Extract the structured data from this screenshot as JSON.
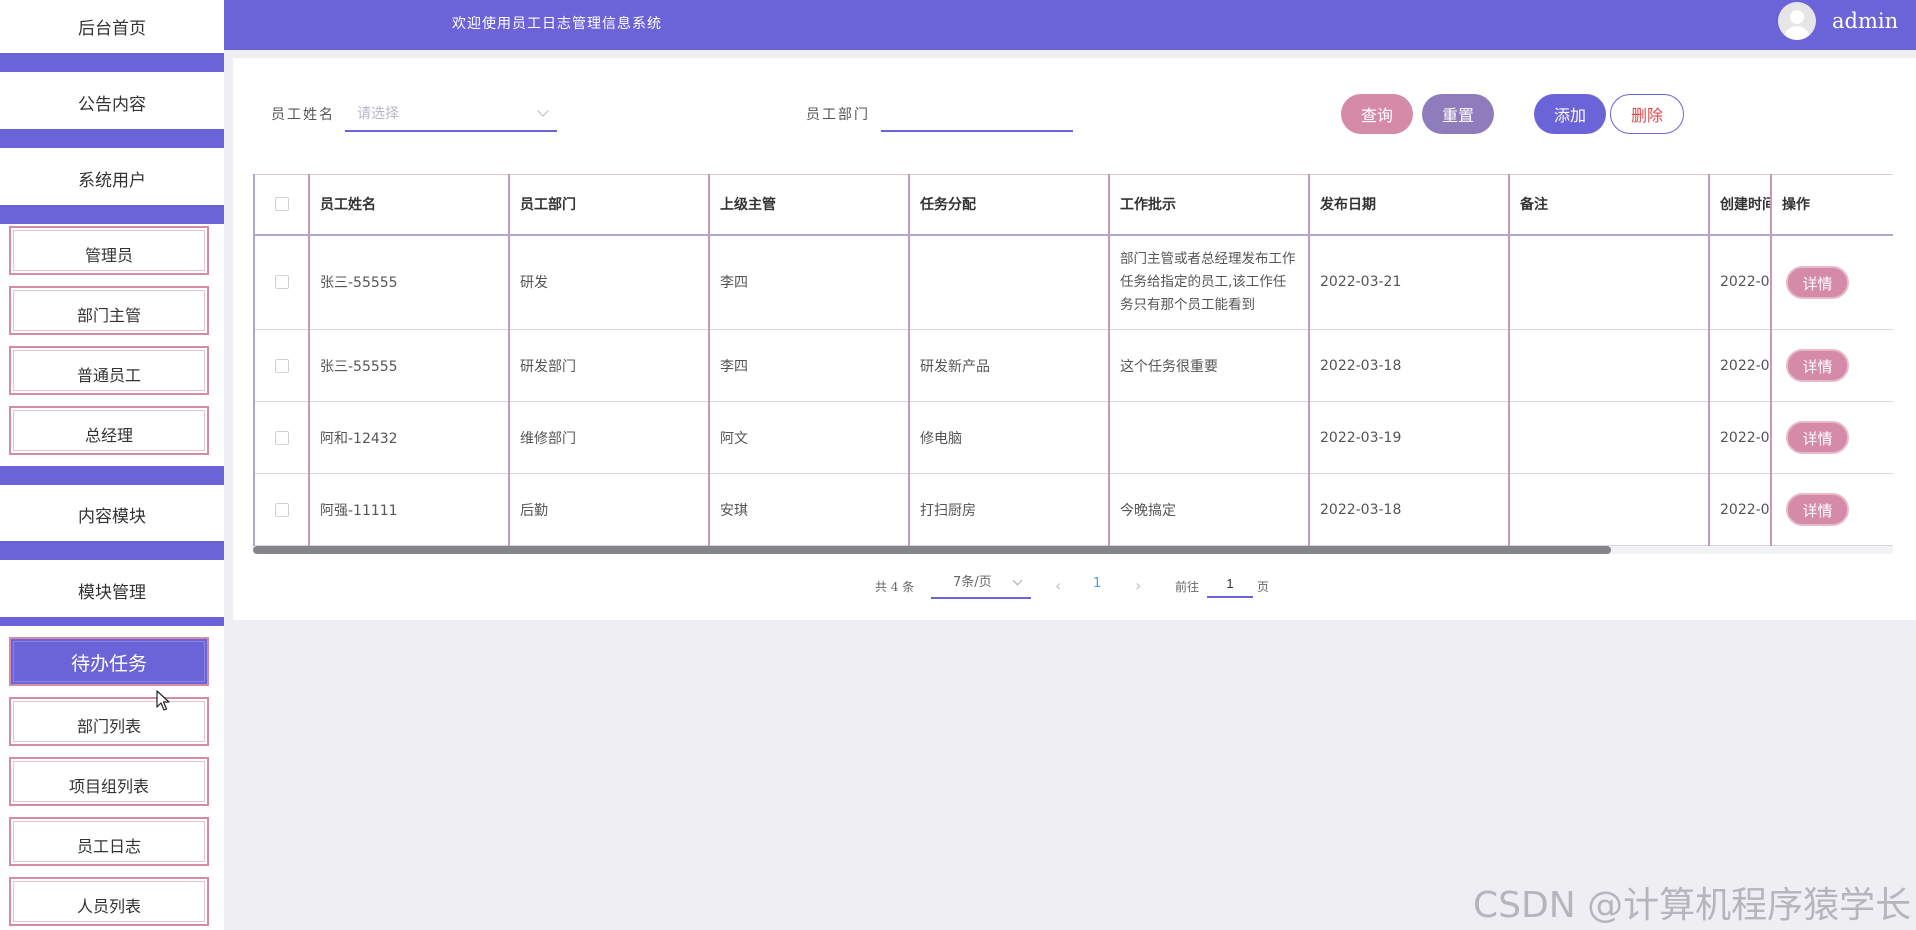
{
  "header": {
    "title": "欢迎使用员工日志管理信息系统",
    "user": "admin"
  },
  "sidebar": {
    "items": [
      {
        "label": "后台首页",
        "type": "main"
      },
      {
        "label": "公告内容",
        "type": "main"
      },
      {
        "label": "系统用户",
        "type": "main"
      },
      {
        "label": "管理员",
        "type": "sub"
      },
      {
        "label": "部门主管",
        "type": "sub"
      },
      {
        "label": "普通员工",
        "type": "sub"
      },
      {
        "label": "总经理",
        "type": "sub"
      },
      {
        "label": "内容模块",
        "type": "main"
      },
      {
        "label": "模块管理",
        "type": "main"
      },
      {
        "label": "待办任务",
        "type": "sub",
        "active": true
      },
      {
        "label": "部门列表",
        "type": "sub"
      },
      {
        "label": "项目组列表",
        "type": "sub"
      },
      {
        "label": "员工日志",
        "type": "sub"
      },
      {
        "label": "人员列表",
        "type": "sub"
      }
    ]
  },
  "search": {
    "name_label": "员工姓名",
    "name_placeholder": "请选择",
    "dept_label": "员工部门",
    "dept_value": ""
  },
  "buttons": {
    "query": "查询",
    "reset": "重置",
    "add": "添加",
    "delete": "删除"
  },
  "table": {
    "columns": [
      "员工姓名",
      "员工部门",
      "上级主管",
      "任务分配",
      "工作批示",
      "发布日期",
      "备注",
      "创建时间",
      "操作"
    ],
    "rows": [
      {
        "name": "张三-55555",
        "dept": "研发",
        "supervisor": "李四",
        "task": "",
        "instruction": "部门主管或者总经理发布工作任务给指定的员工,该工作任务只有那个员工能看到",
        "date": "2022-03-21",
        "note": "",
        "created": "2022-0",
        "action": "详情"
      },
      {
        "name": "张三-55555",
        "dept": "研发部门",
        "supervisor": "李四",
        "task": "研发新产品",
        "instruction": "这个任务很重要",
        "date": "2022-03-18",
        "note": "",
        "created": "2022-0",
        "action": "详情"
      },
      {
        "name": "阿和-12432",
        "dept": "维修部门",
        "supervisor": "阿文",
        "task": "修电脑",
        "instruction": "",
        "date": "2022-03-19",
        "note": "",
        "created": "2022-0",
        "action": "详情"
      },
      {
        "name": "阿强-11111",
        "dept": "后勤",
        "supervisor": "安琪",
        "task": "打扫厨房",
        "instruction": "今晚搞定",
        "date": "2022-03-18",
        "note": "",
        "created": "2022-0",
        "action": "详情"
      }
    ]
  },
  "pagination": {
    "total": "共 4 条",
    "page_size": "7条/页",
    "current_page": "1",
    "goto_label": "前往",
    "goto_value": "1",
    "goto_unit": "页"
  },
  "watermark": "CSDN @计算机程序猿学长",
  "colors": {
    "primary": "#6b63d8",
    "pink": "#d58ba7",
    "reset": "#8f7cbd",
    "delete_text": "#e04a4a"
  }
}
